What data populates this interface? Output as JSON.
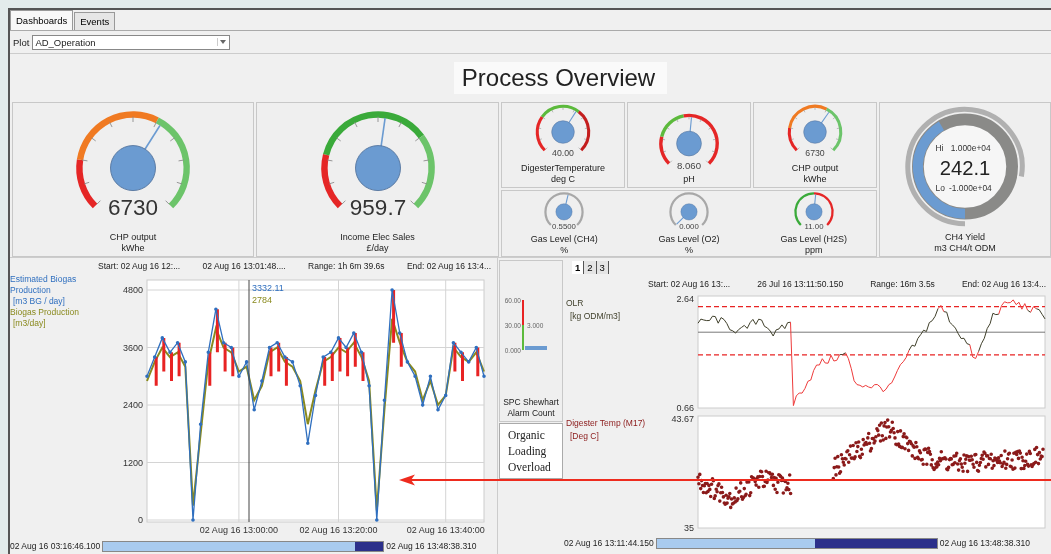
{
  "tabs": [
    {
      "label": "Dashboards",
      "selected": true
    },
    {
      "label": "Events",
      "selected": false
    }
  ],
  "plot": {
    "label": "Plot",
    "value": "AD_Operation"
  },
  "title": "Process Overview",
  "large_gauges": [
    {
      "kind": "chp",
      "value": "6730",
      "label": "CHP output",
      "unit": "kWhe"
    },
    {
      "kind": "income",
      "value": "959.7",
      "label": "Income Elec Sales",
      "unit": "£/day"
    }
  ],
  "small_gauges": [
    {
      "kind": "temperature",
      "value": "40.00",
      "label": "DigesterTemperature",
      "unit": "deg C"
    },
    {
      "kind": "ph",
      "value": "8.060",
      "label": "pH"
    },
    {
      "kind": "chp",
      "value": "6730",
      "label": "CHP output",
      "unit": "kWhe"
    }
  ],
  "mini_gauges": [
    {
      "kind": "gas",
      "value": "0.5500",
      "label": "Gas Level (CH4)",
      "unit": "%"
    },
    {
      "kind": "gas",
      "value": "0.000",
      "label": "Gas Level (O2)",
      "unit": "%"
    },
    {
      "kind": "h2s",
      "value": "11.00",
      "label": "Gas Level (H2S)",
      "unit": "ppm"
    }
  ],
  "yield_ring": {
    "hi_label": "Hi",
    "hi_value": "1.000e+04",
    "value": "242.1",
    "lo_label": "Lo",
    "lo_value": "-1.000e+04",
    "label": "CH4 Yield",
    "unit": "m3 CH4/t ODM"
  },
  "left_chart": {
    "header": [
      "Start: 02 Aug 16 12:...",
      "02 Aug 16 13:01:48....",
      "Range: 1h 6m 39.6s",
      "End: 02 Aug 16 13:4..."
    ],
    "legend_units": [
      "[m3 BG / day]",
      "[m3/day]"
    ],
    "readouts": [
      "3332.11",
      "2784"
    ],
    "chart_data": {
      "type": "line",
      "grid": true,
      "ylim": [
        0,
        4800
      ],
      "yticks": [
        4800,
        3600,
        2400,
        1200,
        0
      ],
      "categories": [
        null,
        null,
        null,
        null,
        null,
        null,
        null,
        null,
        null,
        null,
        null,
        null,
        "02 Aug 16 13:00:00",
        null,
        null,
        null,
        null,
        null,
        null,
        null,
        null,
        null,
        null,
        null,
        null,
        "02 Aug 16 13:20:00",
        null,
        null,
        null,
        null,
        null,
        null,
        null,
        null,
        null,
        null,
        null,
        null,
        null,
        "02 Aug 16 13:40:00",
        null,
        null,
        null,
        null,
        null
      ],
      "series": [
        {
          "name": "Estimated Biogas Production",
          "color": "#2f6fbf",
          "marker": "circle",
          "values": [
            3000,
            3400,
            3800,
            3500,
            3700,
            3300,
            0,
            2000,
            3500,
            4400,
            3700,
            3600,
            3000,
            3300,
            2300,
            2900,
            3600,
            3700,
            3400,
            3300,
            2800,
            1600,
            2600,
            3400,
            3500,
            3800,
            3600,
            3900,
            3500,
            2800,
            0,
            2500,
            4800,
            3900,
            3300,
            3000,
            2400,
            3000,
            2300,
            2600,
            3700,
            3500,
            3300,
            3600,
            3000
          ]
        },
        {
          "name": "Biogas Production",
          "color": "#8a8a1e",
          "values": [
            2900,
            3300,
            3600,
            3400,
            3500,
            3200,
            300,
            1800,
            3300,
            4000,
            3600,
            3500,
            3100,
            3200,
            2500,
            2800,
            3500,
            3600,
            3300,
            3200,
            2900,
            2000,
            2700,
            3300,
            3400,
            3600,
            3500,
            3700,
            3400,
            2900,
            200,
            2300,
            4200,
            3700,
            3300,
            3100,
            2500,
            2900,
            2400,
            2600,
            3600,
            3400,
            3300,
            3500,
            3100
          ]
        }
      ]
    },
    "range_start": "02 Aug 16 03:16:46.100",
    "range_end": "02 Aug 16 13:48:38.310"
  },
  "spc": {
    "ticks": [
      "60.00",
      "30.00",
      "0.000"
    ],
    "value": "3.000",
    "label": "SPC Shewhart Alarm Count",
    "alarm": "Organic Loading Overload"
  },
  "right_panel": {
    "tabs": [
      {
        "label": "1",
        "selected": true
      },
      {
        "label": "2",
        "selected": false
      },
      {
        "label": "3",
        "selected": false
      }
    ],
    "header": [
      "Start: 02 Aug 16 13:...",
      "26 Jul 16 13:11:50.150",
      "Range: 16m 3.5s",
      "End: 02 Aug 16 13:4..."
    ],
    "charts": [
      {
        "kind": "line",
        "name": "OLR",
        "unit": "[kg ODM/m3]",
        "ymax": "2.64",
        "ymin": "0.66"
      },
      {
        "kind": "scatter",
        "name": "Digester Temp (M17)",
        "unit": "[Deg C]",
        "ymax": "43.67",
        "ymin": "35"
      }
    ],
    "range_start": "02 Aug 16 13:11:44.150",
    "range_end": "02 Aug 16 13:48:38.310"
  }
}
